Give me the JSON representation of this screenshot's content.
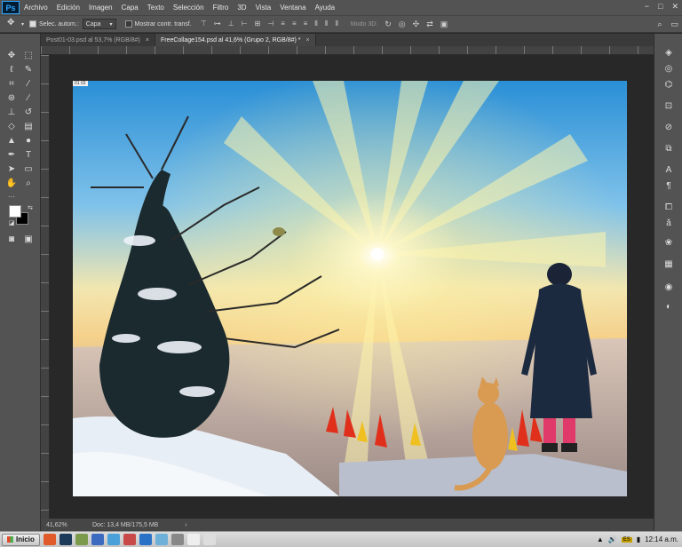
{
  "app": {
    "logo": "Ps",
    "menu": [
      "Archivo",
      "Edición",
      "Imagen",
      "Capa",
      "Texto",
      "Selección",
      "Filtro",
      "3D",
      "Vista",
      "Ventana",
      "Ayuda"
    ],
    "window_controls": [
      "−",
      "□",
      "✕"
    ]
  },
  "options": {
    "auto_select_label": "Selec. autom.:",
    "auto_select_value": "Capa",
    "show_transform_label": "Mostrar contr. transf.",
    "mode3d_label": "Modo 3D:"
  },
  "tabs": [
    {
      "label": "Post01-03.psd al 53,7% (RGB/8#)",
      "close": "×",
      "active": false
    },
    {
      "label": "FreeCollage154.psd al 41,6% (Grupo 2, RGB/8#) *",
      "close": "×",
      "active": true
    }
  ],
  "status": {
    "zoom": "41,62%",
    "doc": "Doc: 13,4 MB/175,5 MB",
    "arrow": "›"
  },
  "canvas": {
    "layer_badge": "01 02"
  },
  "toolbar_icons": [
    "move-icon",
    "marquee-icon",
    "lasso-icon",
    "quick-select-icon",
    "crop-icon",
    "eyedropper-icon",
    "healing-icon",
    "brush-icon",
    "stamp-icon",
    "history-brush-icon",
    "eraser-icon",
    "gradient-icon",
    "blur-icon",
    "dodge-icon",
    "pen-icon",
    "type-icon",
    "path-select-icon",
    "shape-icon",
    "hand-icon",
    "zoom-icon"
  ],
  "colors": {
    "foreground": "#ffffff",
    "background": "#000000",
    "ui_dark": "#535353",
    "canvas_bg": "#282828"
  },
  "taskbar": {
    "start_label": "Inicio",
    "clock": "12:14 a.m.",
    "battery": "ES"
  }
}
